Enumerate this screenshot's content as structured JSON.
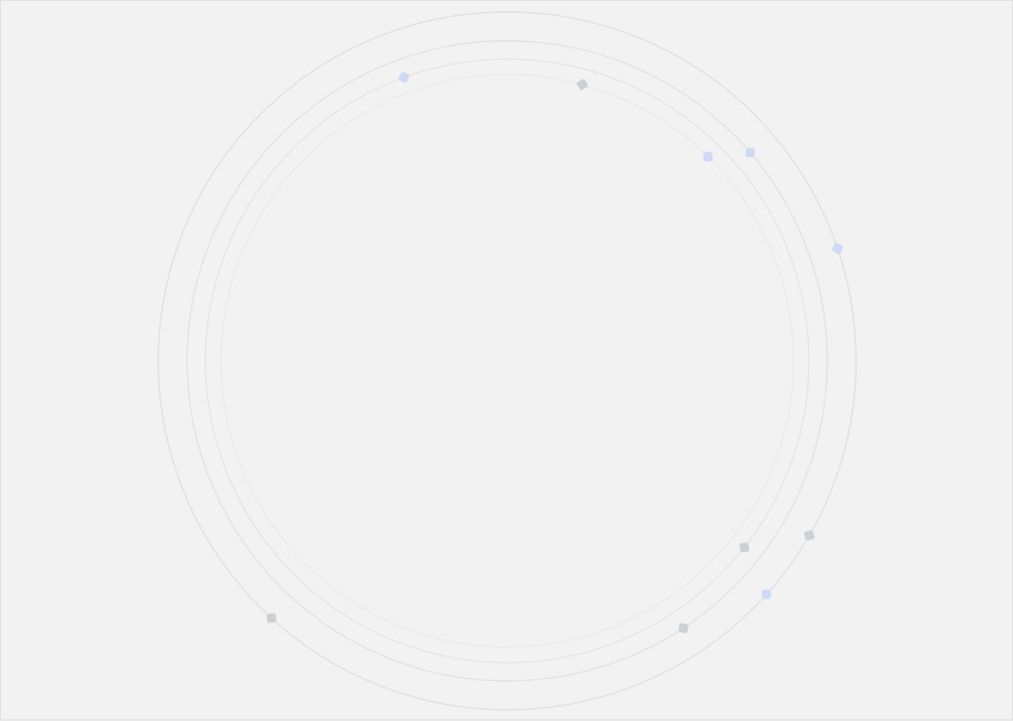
{
  "background_color": "#f2f2f2",
  "ring_colors": [
    "#d9d9d9",
    "#dcdcdc",
    "#dedede",
    "#e4e4e4"
  ],
  "marker_colors": {
    "blue": "#cdd9f5",
    "gray": "#ccd0d3"
  },
  "rings": [
    {
      "name": "ring-outer",
      "markers": [
        "blue",
        "gray",
        "blue",
        "gray"
      ]
    },
    {
      "name": "ring-second",
      "markers": [
        "blue",
        "gray"
      ]
    },
    {
      "name": "ring-third",
      "markers": [
        "blue",
        "gray"
      ]
    },
    {
      "name": "ring-inner",
      "markers": [
        "gray",
        "blue"
      ]
    }
  ]
}
